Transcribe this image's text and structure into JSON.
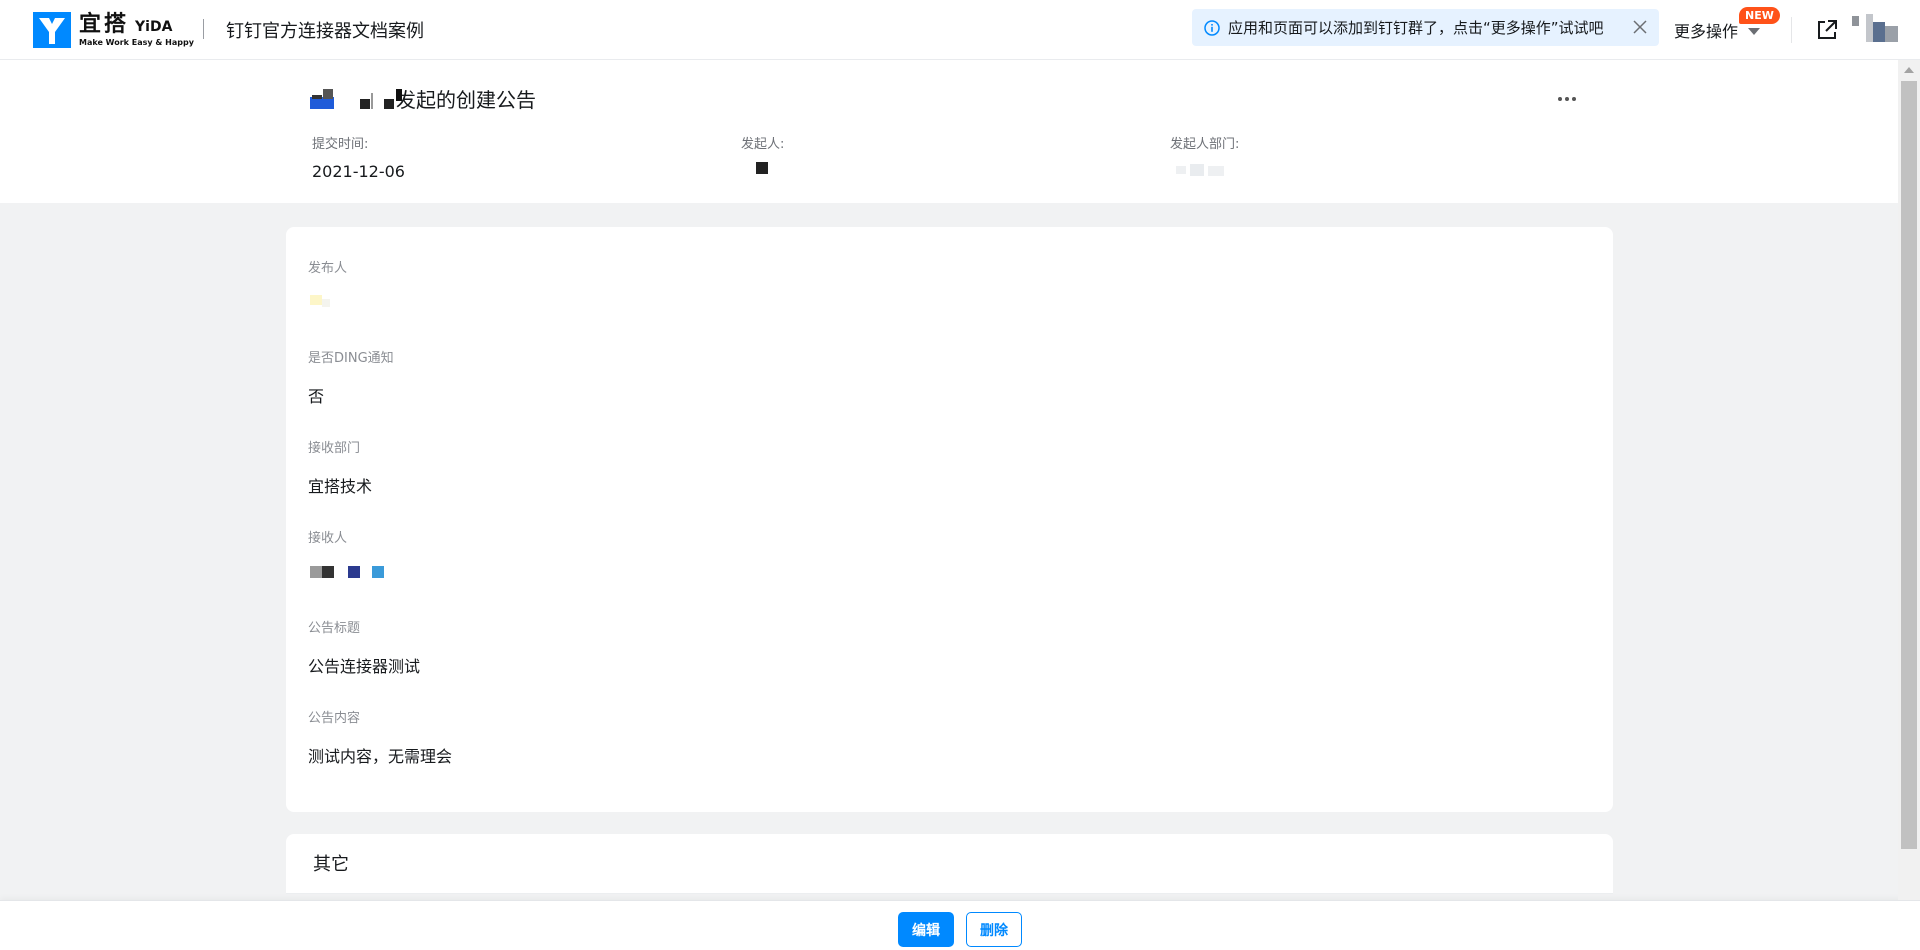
{
  "brand": {
    "cn": "宜搭",
    "en": "YiDA",
    "slogan": "Make Work Easy & Happy",
    "color": "#0089ff"
  },
  "app": {
    "name": "钉钉官方连接器文档案例"
  },
  "notice": {
    "text": "应用和页面可以添加到钉钉群了，点击“更多操作”试试吧",
    "icon": "info-icon",
    "close_icon": "close-icon"
  },
  "toolbar": {
    "more_actions_label": "更多操作",
    "new_badge": "NEW",
    "open_icon": "open-in-new-icon"
  },
  "header": {
    "title_suffix": "发起的创建公告",
    "submit_time_label": "提交时间:",
    "submit_time": "2021-12-06",
    "initiator_label": "发起人:",
    "initiator_dept_label": "发起人部门:"
  },
  "form": {
    "fields": [
      {
        "label": "发布人",
        "value": ""
      },
      {
        "label": "是否DING通知",
        "value": "否"
      },
      {
        "label": "接收部门",
        "value": "宜搭技术"
      },
      {
        "label": "接收人",
        "value": ""
      },
      {
        "label": "公告标题",
        "value": "公告连接器测试"
      },
      {
        "label": "公告内容",
        "value": "测试内容，无需理会"
      }
    ]
  },
  "other": {
    "title": "其它"
  },
  "actions": {
    "edit_label": "编辑",
    "delete_label": "删除"
  },
  "colors": {
    "accent": "#0089ff",
    "badge": "#ff5219",
    "notice_bg": "#e6f2ff",
    "page_bg": "#f1f2f3"
  }
}
